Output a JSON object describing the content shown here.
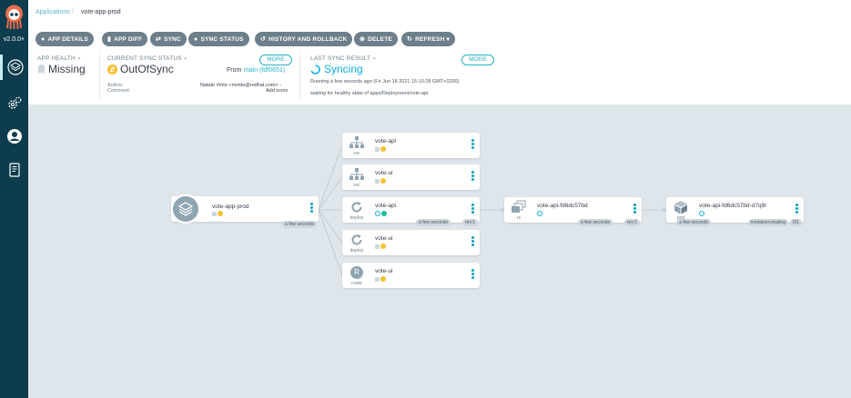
{
  "app": {
    "version": "v2.0.0+",
    "colors": {
      "sidebar": "#0d3c4d",
      "accent": "#26b1c9",
      "button": "#6d7f8b",
      "outofsync": "#f4c030",
      "synced": "#18be94",
      "progressing": "#0dadea",
      "missing": "#ccd6dd"
    }
  },
  "sidebar": {
    "items": [
      {
        "name": "applications",
        "icon": "layers-icon"
      },
      {
        "name": "settings",
        "icon": "gears-icon"
      },
      {
        "name": "user-info",
        "icon": "user-circle-icon"
      },
      {
        "name": "documentation",
        "icon": "book-icon"
      }
    ]
  },
  "breadcrumb": {
    "parent": "Applications",
    "current": "vote-app-prod"
  },
  "toolbar": {
    "app_details": "APP DETAILS",
    "app_diff": "APP DIFF",
    "sync": "SYNC",
    "sync_status": "SYNC STATUS",
    "history": "HISTORY AND ROLLBACK",
    "delete": "DELETE",
    "refresh": "REFRESH"
  },
  "status": {
    "health": {
      "label": "APP HEALTH",
      "value": "Missing"
    },
    "sync": {
      "label": "CURRENT SYNC STATUS",
      "more": "MORE",
      "value": "OutOfSync",
      "from_label": "From",
      "from_value": "main (fdf0651)",
      "author_label": "Author:",
      "author_value": "Natale Vinto <nvinto@redhat.com> -",
      "comment_label": "Comment:",
      "comment_value": "Add icons"
    },
    "last_sync": {
      "label": "LAST SYNC RESULT",
      "more": "MORE",
      "value": "Syncing",
      "running": "Running a few seconds ago (Fri Jun 18 2021 15:10:28 GMT+0200)",
      "message": "waiting for healthy state of apps/Deployment/vote-api"
    }
  },
  "graph": {
    "root": {
      "name": "vote-app-prod",
      "tags": [
        "a few seconds"
      ]
    },
    "nodes": [
      {
        "name": "vote-api",
        "kind": "svc",
        "tags": []
      },
      {
        "name": "vote-ui",
        "kind": "svc",
        "tags": []
      },
      {
        "name": "vote-api",
        "kind": "deploy",
        "tags": [
          "a few seconds",
          "rev:1"
        ]
      },
      {
        "name": "vote-ui",
        "kind": "deploy",
        "tags": []
      },
      {
        "name": "vote-ui",
        "kind": "route",
        "tags": []
      }
    ],
    "rs": {
      "name": "vote-api-fd6dc57bd",
      "kind": "rs",
      "tags": [
        "a few seconds",
        "rev:1"
      ]
    },
    "pod": {
      "name": "vote-api-fd6dc57bd-d7q9r",
      "kind": "pod",
      "tags": [
        "a few seconds",
        "containercreating",
        "0/1"
      ]
    },
    "route_letter": "R"
  }
}
